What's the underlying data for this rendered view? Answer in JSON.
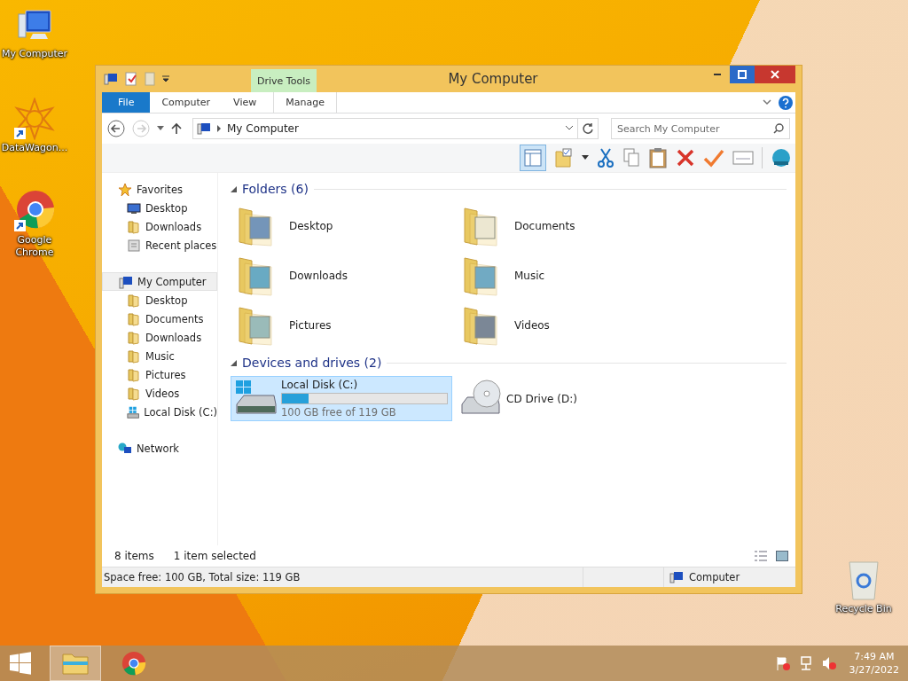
{
  "desktop_icons": [
    {
      "kind": "computer",
      "label": "My Computer",
      "shortcut": false
    },
    {
      "kind": "app",
      "label": "DataWagon...",
      "shortcut": true
    },
    {
      "kind": "chrome",
      "label": "Google Chrome",
      "shortcut": true
    },
    {
      "kind": "recycle",
      "label": "Recycle Bin",
      "shortcut": false
    }
  ],
  "window": {
    "title": "My Computer",
    "context_group": "Drive Tools",
    "ribbon_tabs": [
      {
        "kind": "file",
        "label": "File"
      },
      {
        "kind": "tab",
        "label": "Computer"
      },
      {
        "kind": "tab",
        "label": "View"
      },
      {
        "kind": "context",
        "label": "Manage"
      }
    ],
    "address": {
      "path": "My Computer",
      "search_placeholder": "Search My Computer"
    },
    "preview_pane_on": true,
    "sidebar": [
      {
        "kind": "star",
        "label": "Favorites",
        "selected": false,
        "children": [
          {
            "kind": "monitor",
            "label": "Desktop",
            "selected": false
          },
          {
            "kind": "folder",
            "label": "Downloads",
            "selected": false
          },
          {
            "kind": "recent",
            "label": "Recent places",
            "selected": false
          }
        ]
      },
      {
        "kind": "computer",
        "label": "My Computer",
        "selected": true,
        "children": [
          {
            "kind": "folder",
            "label": "Desktop",
            "selected": false
          },
          {
            "kind": "folder",
            "label": "Documents",
            "selected": false
          },
          {
            "kind": "folder",
            "label": "Downloads",
            "selected": false
          },
          {
            "kind": "folder",
            "label": "Music",
            "selected": false
          },
          {
            "kind": "folder",
            "label": "Pictures",
            "selected": false
          },
          {
            "kind": "folder",
            "label": "Videos",
            "selected": false
          },
          {
            "kind": "drive",
            "label": "Local Disk (C:)",
            "selected": false
          }
        ]
      },
      {
        "kind": "network",
        "label": "Network",
        "selected": false
      }
    ],
    "folders": {
      "heading": "Folders (6)",
      "items": [
        {
          "kind": "desktop",
          "label": "Desktop"
        },
        {
          "kind": "documents",
          "label": "Documents"
        },
        {
          "kind": "downloads",
          "label": "Downloads"
        },
        {
          "kind": "music",
          "label": "Music"
        },
        {
          "kind": "pictures",
          "label": "Pictures"
        },
        {
          "kind": "videos",
          "label": "Videos"
        }
      ]
    },
    "drives": {
      "heading": "Devices and drives (2)",
      "items": [
        {
          "kind": "disk",
          "label": "Local Disk (C:)",
          "level": 0.16,
          "caption": "100 GB free of 119 GB",
          "selected": true
        },
        {
          "kind": "cd",
          "label": "CD Drive (D:)",
          "selected": false
        }
      ]
    },
    "status": {
      "items": "8 items",
      "selection": "1 item selected",
      "details": "Space free: 100 GB, Total size: 119 GB",
      "location": "Computer"
    }
  },
  "taskbar": {
    "apps": [
      {
        "kind": "explorer",
        "active": true
      },
      {
        "kind": "chrome",
        "active": false
      }
    ],
    "time": "7:49 AM",
    "date": "3/27/2022"
  }
}
